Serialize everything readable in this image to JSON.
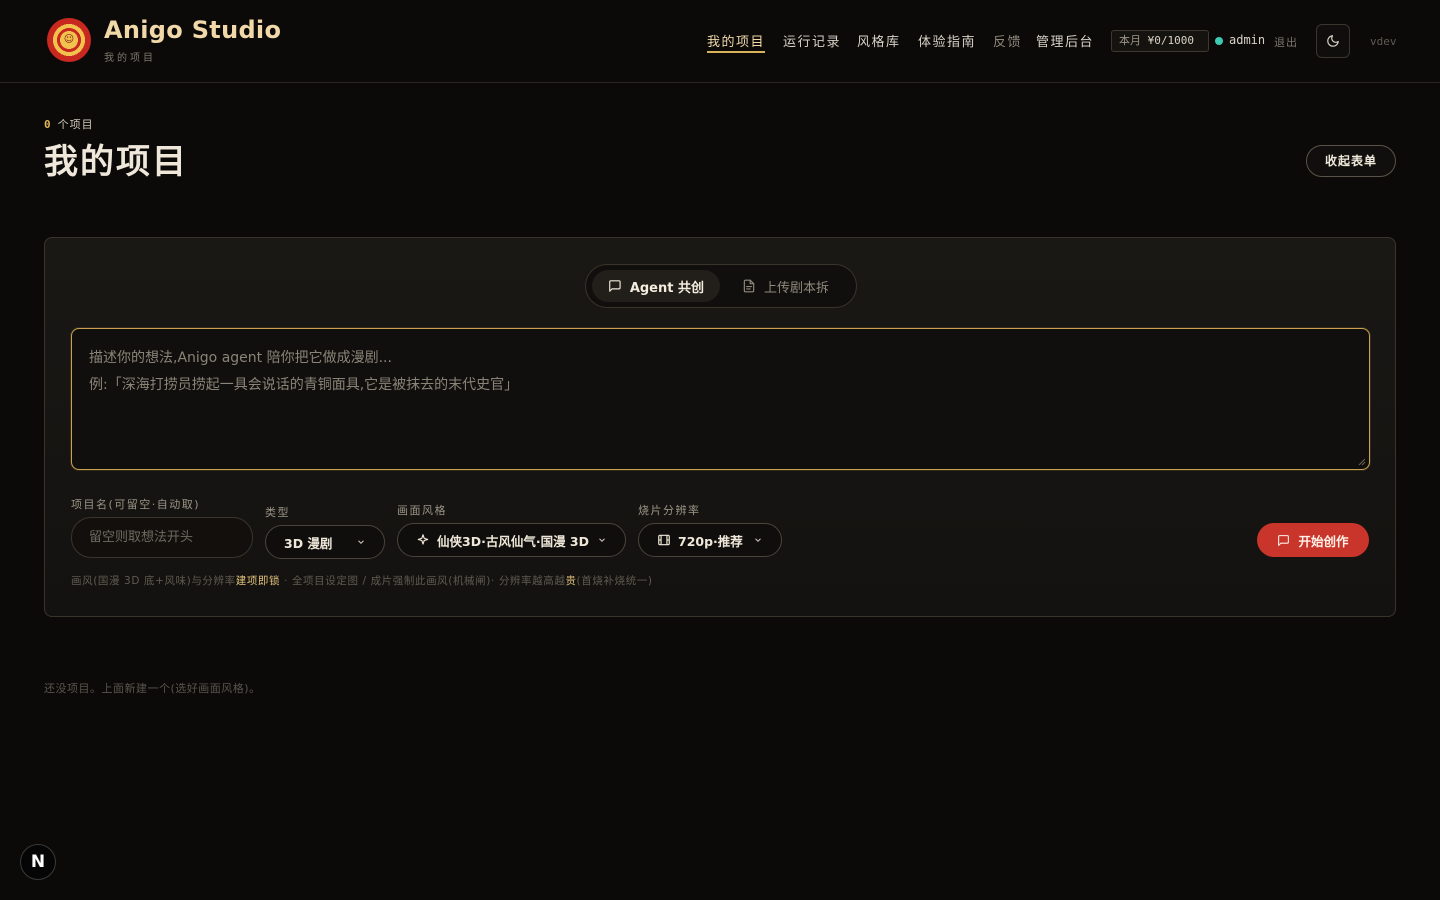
{
  "brand": {
    "name": "Anigo Studio",
    "subtitle": "我的项目"
  },
  "nav": {
    "items": [
      {
        "label": "我的项目",
        "active": true
      },
      {
        "label": "运行记录"
      },
      {
        "label": "风格库"
      },
      {
        "label": "体验指南"
      },
      {
        "label": "反馈",
        "dim": true
      },
      {
        "label": "管理后台"
      }
    ]
  },
  "quota": {
    "label": "本月",
    "value": "¥0/1000"
  },
  "user": {
    "name": "admin",
    "logout": "退出",
    "status_color": "#3ec9b3"
  },
  "version": "vdev",
  "page": {
    "count": "0",
    "count_suffix": "个项目",
    "title": "我的项目",
    "collapse_label": "收起表单"
  },
  "modes": {
    "active": "Agent 共创",
    "inactive": "上传剧本拆"
  },
  "prompt": {
    "placeholder": "描述你的想法,Anigo agent 陪你把它做成漫剧...\n例:「深海打捞员捞起一具会说话的青铜面具,它是被抹去的末代史官」"
  },
  "form": {
    "name_label": "项目名(可留空·自动取)",
    "name_placeholder": "留空则取想法开头",
    "type_label": "类型",
    "type_value": "3D 漫剧",
    "style_label": "画面风格",
    "style_value": "仙侠3D·古风仙气·国漫 3D",
    "res_label": "烧片分辨率",
    "res_value": "720p·推荐",
    "start_label": "开始创作"
  },
  "hint": {
    "part1": "画风(国漫 3D 底+风味)与分辨率",
    "hl1": "建项即锁",
    "part2": " · 全项目设定图 / 成片强制此画风(机械闸)· 分辨率越高越",
    "hl2": "贵",
    "part3": "(首烧补烧统一)"
  },
  "empty_state": "还没项目。上面新建一个(选好画面风格)。",
  "dev_badge": "N",
  "colors": {
    "accent": "#d9b25c",
    "primary_button": "#c9352a",
    "background": "#0b0a09"
  }
}
